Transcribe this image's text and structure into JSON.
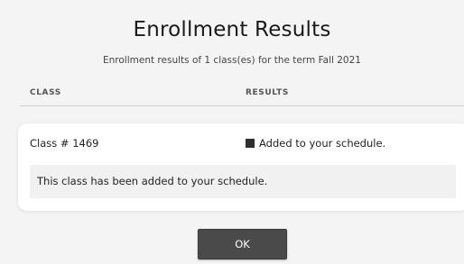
{
  "dialog": {
    "title": "Enrollment Results",
    "subtitle": "Enrollment results of 1 class(es) for the term Fall 2021"
  },
  "table": {
    "columns": [
      "CLASS",
      "RESULTS"
    ],
    "rows": [
      {
        "class": "Class # 1469",
        "result": "Added to your schedule.",
        "message": "This class has been added to your schedule."
      }
    ]
  },
  "actions": {
    "ok_label": "OK"
  },
  "colors": {
    "button": "#4a4a4a",
    "status_indicator": "#2e2e2e",
    "card_background": "#ffffff",
    "page_background": "#f4f4f4"
  }
}
